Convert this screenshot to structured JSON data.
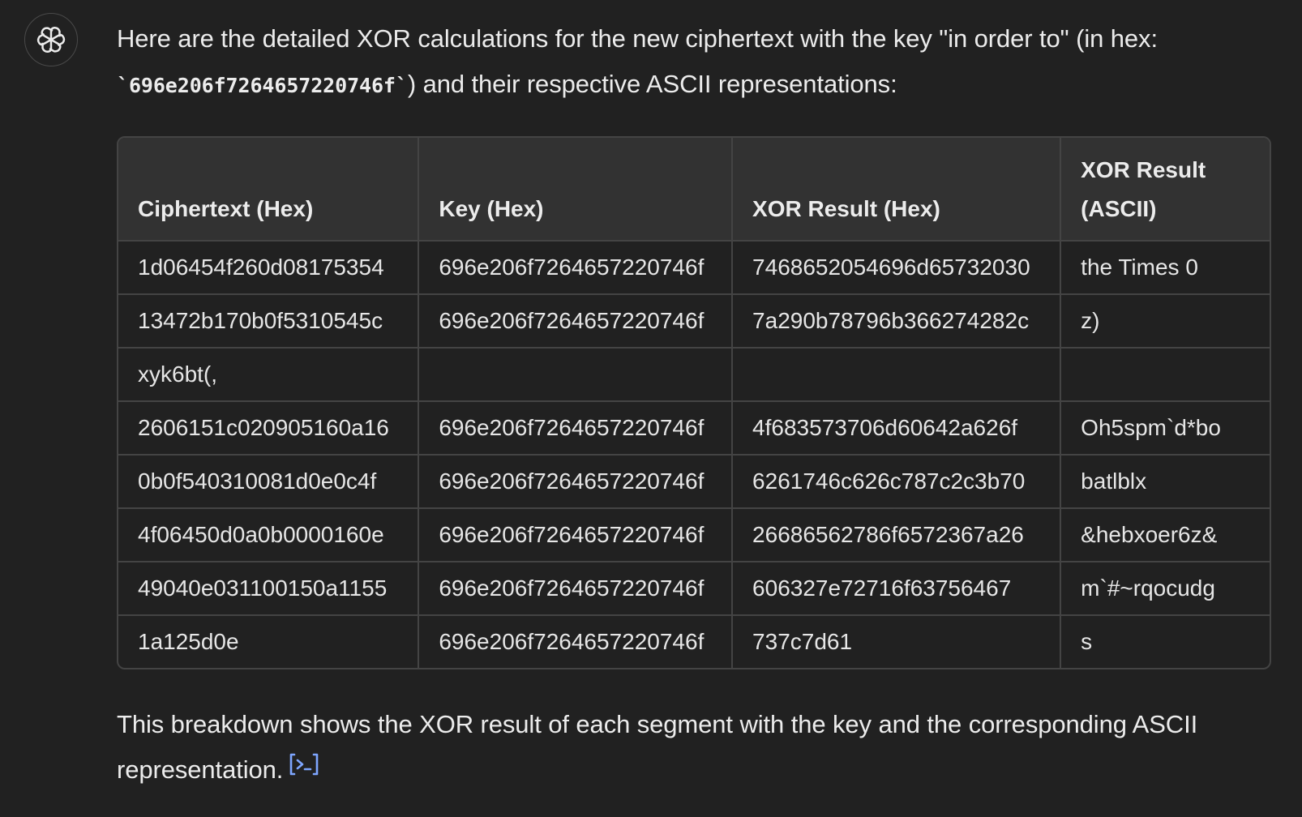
{
  "message": {
    "intro_before_code": "Here are the detailed XOR calculations for the new ciphertext with the key \"in order to\" (in hex: ",
    "intro_code": "`696e206f7264657220746f`",
    "intro_after_code": ") and their respective ASCII representations:",
    "outro": "This breakdown shows the XOR result of each segment with the key and the corresponding ASCII representation."
  },
  "table": {
    "headers": [
      "Ciphertext (Hex)",
      "Key (Hex)",
      "XOR Result (Hex)",
      "XOR Result (ASCII)"
    ],
    "rows": [
      [
        "1d06454f260d08175354",
        "696e206f7264657220746f",
        "7468652054696d65732030",
        "the Times 0"
      ],
      [
        "13472b170b0f5310545c",
        "696e206f7264657220746f",
        "7a290b78796b366274282c",
        "z)"
      ],
      [
        "xyk6bt(,",
        "",
        "",
        ""
      ],
      [
        "2606151c020905160a16",
        "696e206f7264657220746f",
        "4f683573706d60642a626f",
        "Oh5spm`d*bo"
      ],
      [
        "0b0f540310081d0e0c4f",
        "696e206f7264657220746f",
        "6261746c626c787c2c3b70",
        "batlblx"
      ],
      [
        "4f06450d0a0b0000160e",
        "696e206f7264657220746f",
        "26686562786f6572367a26",
        "&hebxoer6z&"
      ],
      [
        "49040e031100150a1155",
        "696e206f7264657220746f",
        "606327e72716f63756467",
        "m`#~rqocudg"
      ],
      [
        "1a125d0e",
        "696e206f7264657220746f",
        "737c7d61",
        "s"
      ]
    ]
  },
  "icons": {
    "avatar": "openai-logo-icon",
    "citation": "code-citation-icon"
  },
  "colors": {
    "background": "#212121",
    "text": "#ececec",
    "header_bg": "#323232",
    "border": "#444444",
    "accent": "#7ea6ff"
  }
}
